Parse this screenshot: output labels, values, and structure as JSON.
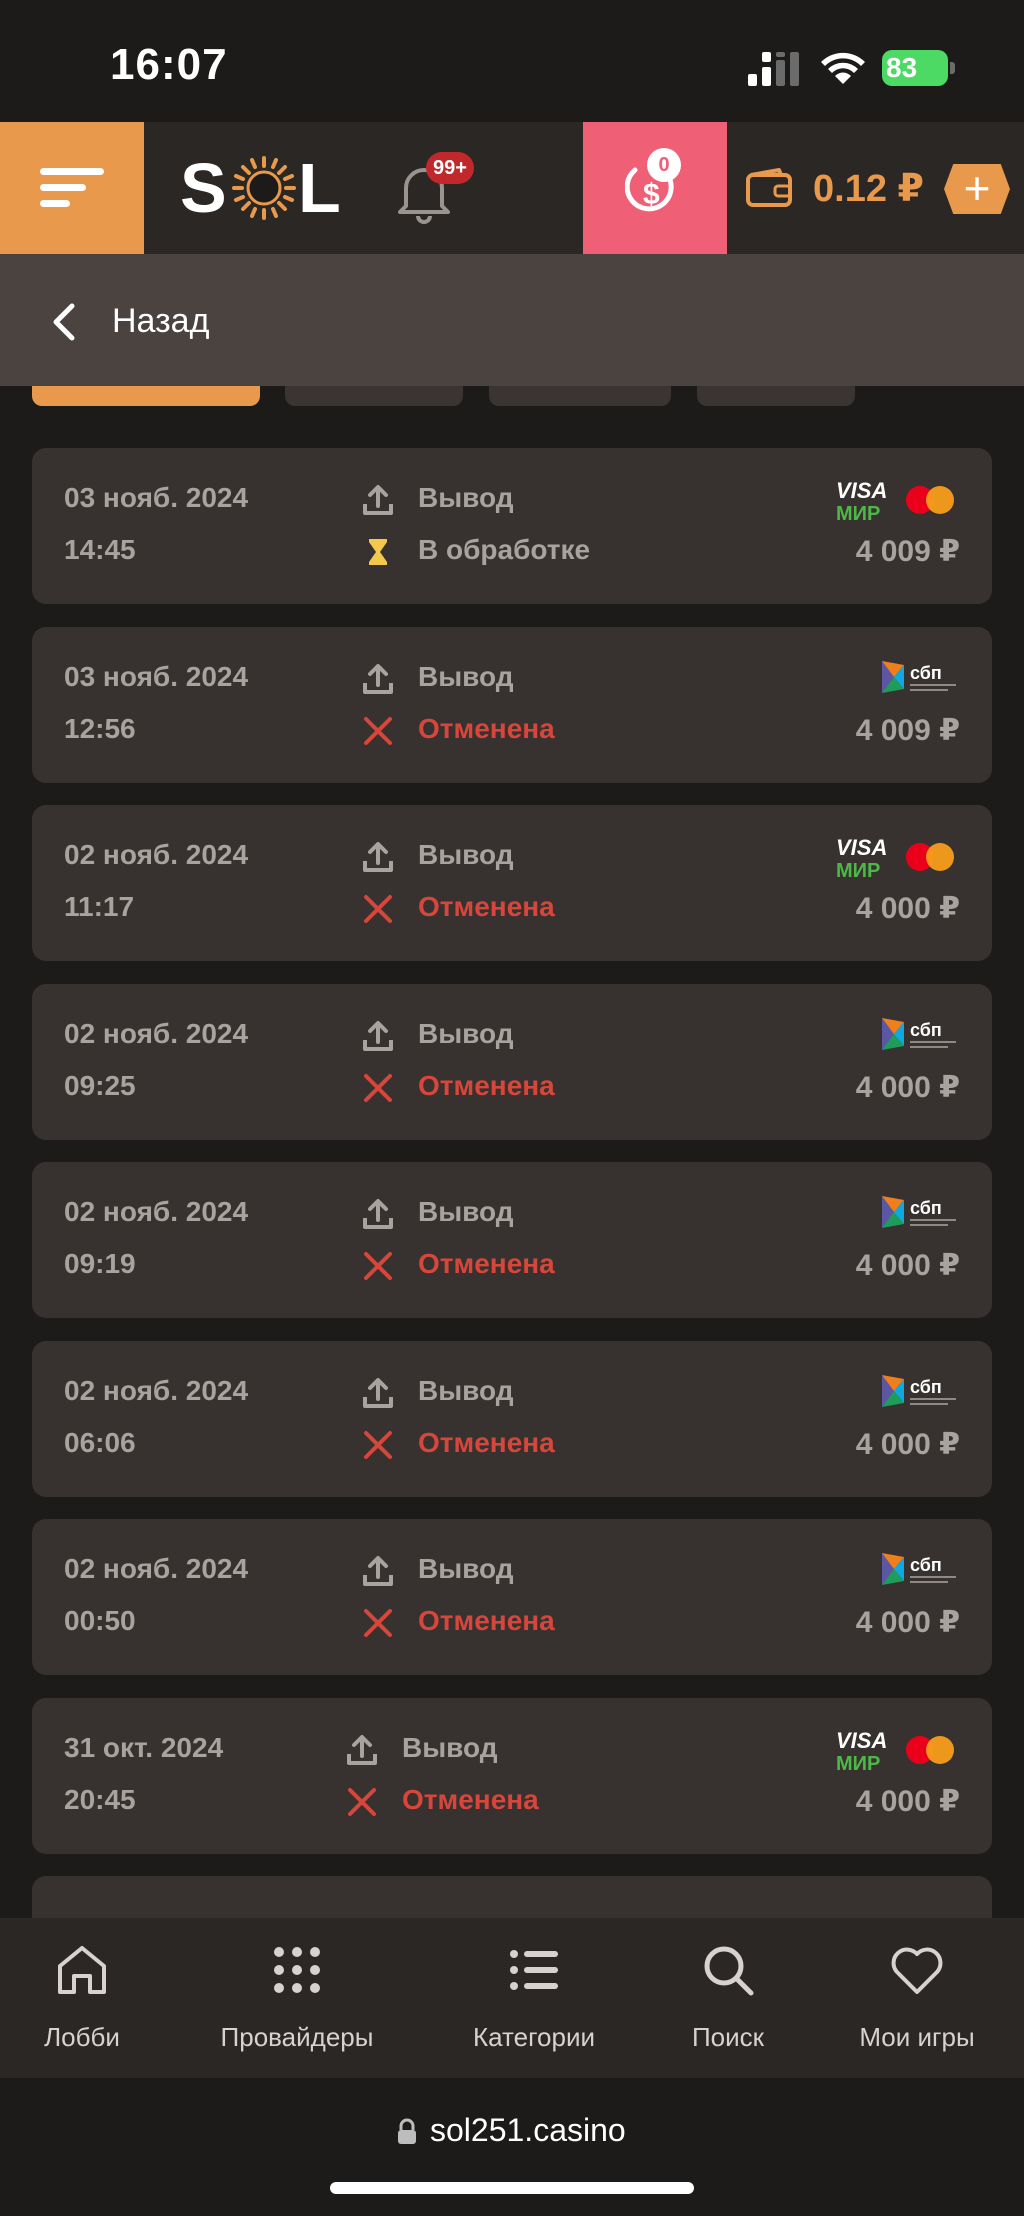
{
  "status_bar": {
    "time": "16:07",
    "battery": "83"
  },
  "header": {
    "logo_left": "S",
    "logo_right": "L",
    "notifications_badge": "99+",
    "bonus_badge": "0",
    "balance": "0.12 ₽",
    "plus_label": "+"
  },
  "back": {
    "label": "Назад"
  },
  "transactions": [
    {
      "date": "03 нояб. 2024",
      "time": "14:45",
      "type": "Вывод",
      "status": "В обработке",
      "status_kind": "pending",
      "amount": "4 009 ₽",
      "method": "visa-mir"
    },
    {
      "date": "03 нояб. 2024",
      "time": "12:56",
      "type": "Вывод",
      "status": "Отменена",
      "status_kind": "cancelled",
      "amount": "4 009 ₽",
      "method": "sbp"
    },
    {
      "date": "02 нояб. 2024",
      "time": "11:17",
      "type": "Вывод",
      "status": "Отменена",
      "status_kind": "cancelled",
      "amount": "4 000 ₽",
      "method": "visa-mir"
    },
    {
      "date": "02 нояб. 2024",
      "time": "09:25",
      "type": "Вывод",
      "status": "Отменена",
      "status_kind": "cancelled",
      "amount": "4 000 ₽",
      "method": "sbp"
    },
    {
      "date": "02 нояб. 2024",
      "time": "09:19",
      "type": "Вывод",
      "status": "Отменена",
      "status_kind": "cancelled",
      "amount": "4 000 ₽",
      "method": "sbp"
    },
    {
      "date": "02 нояб. 2024",
      "time": "06:06",
      "type": "Вывод",
      "status": "Отменена",
      "status_kind": "cancelled",
      "amount": "4 000 ₽",
      "method": "sbp"
    },
    {
      "date": "02 нояб. 2024",
      "time": "00:50",
      "type": "Вывод",
      "status": "Отменена",
      "status_kind": "cancelled",
      "amount": "4 000 ₽",
      "method": "sbp"
    },
    {
      "date": "31 окт. 2024",
      "time": "20:45",
      "type": "Вывод",
      "status": "Отменена",
      "status_kind": "cancelled",
      "amount": "4 000 ₽",
      "method": "visa-mir"
    }
  ],
  "payment_logos": {
    "visa": "VISA",
    "mir": "МИР",
    "sbp": "сбп"
  },
  "bottom_nav": [
    {
      "label": "Лобби",
      "icon": "home-icon"
    },
    {
      "label": "Провайдеры",
      "icon": "grid-icon"
    },
    {
      "label": "Категории",
      "icon": "list-icon"
    },
    {
      "label": "Поиск",
      "icon": "search-icon"
    },
    {
      "label": "Мои игры",
      "icon": "heart-icon"
    }
  ],
  "browser": {
    "url": "sol251.casino"
  },
  "colors": {
    "accent": "#e8994c",
    "bonus": "#ef5f75",
    "cancelled": "#d7463a",
    "pending": "#f2c94c",
    "card_bg": "#373230"
  }
}
